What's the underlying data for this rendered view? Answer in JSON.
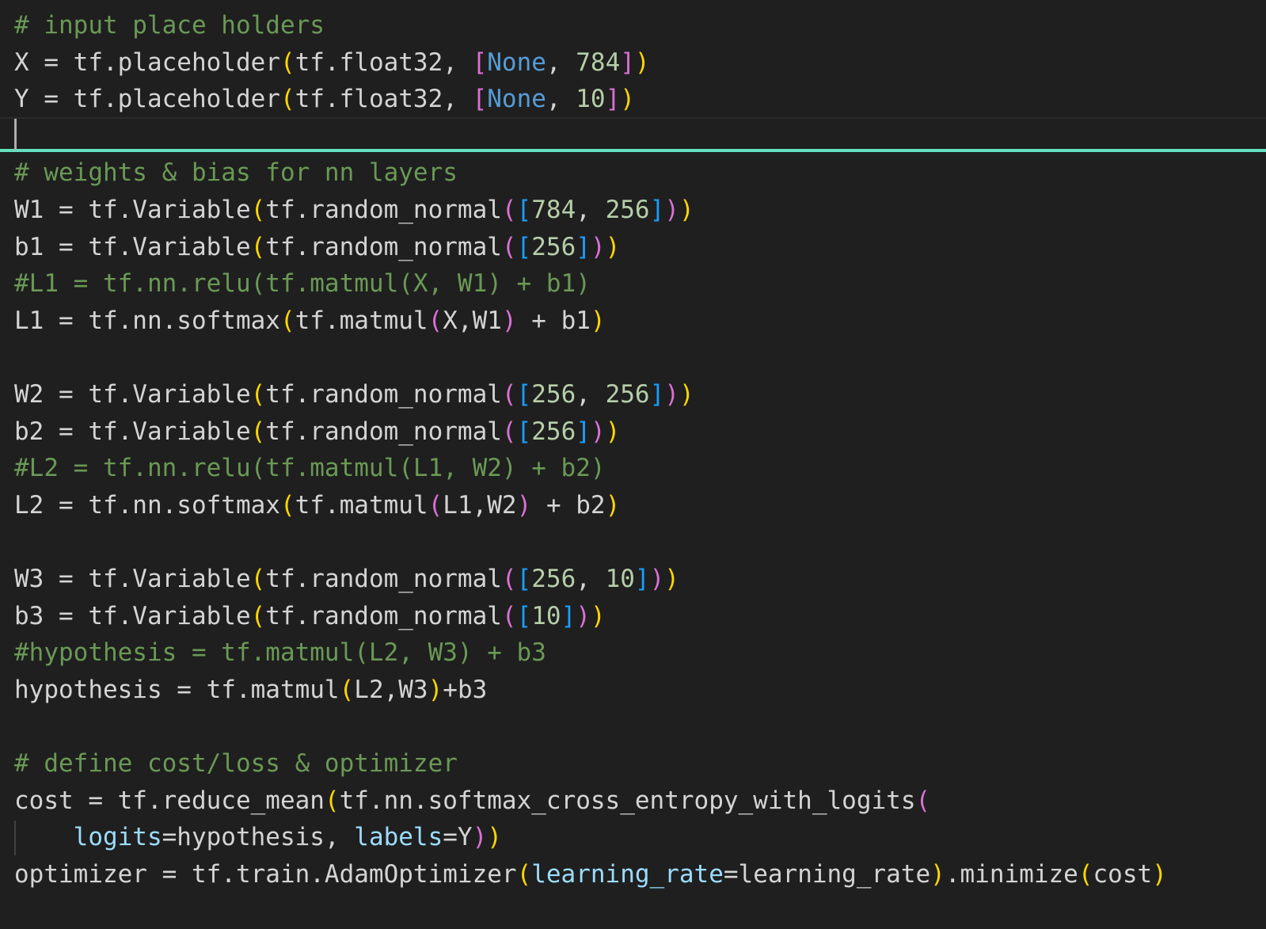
{
  "editor": {
    "colors": {
      "background": "#1f1f1f",
      "text": "#d4d4d4",
      "comment": "#6a9955",
      "number": "#b5cea8",
      "keyword": "#569cd6",
      "parameter": "#9cdcfe",
      "bracket_level_1": "#ffd700",
      "bracket_level_2": "#da70d6",
      "bracket_level_3": "#179fff",
      "active_line_border": "#64e0c0"
    },
    "lines": [
      {
        "tokens": [
          {
            "t": "# input place holders",
            "c": "cmt"
          }
        ]
      },
      {
        "tokens": [
          {
            "t": "X = tf.placeholder",
            "c": ""
          },
          {
            "t": "(",
            "c": "b1"
          },
          {
            "t": "tf.float32, ",
            "c": ""
          },
          {
            "t": "[",
            "c": "b2"
          },
          {
            "t": "None",
            "c": "kw"
          },
          {
            "t": ", ",
            "c": ""
          },
          {
            "t": "784",
            "c": "num"
          },
          {
            "t": "]",
            "c": "b2"
          },
          {
            "t": ")",
            "c": "b1"
          }
        ]
      },
      {
        "tokens": [
          {
            "t": "Y = tf.placeholder",
            "c": ""
          },
          {
            "t": "(",
            "c": "b1"
          },
          {
            "t": "tf.float32, ",
            "c": ""
          },
          {
            "t": "[",
            "c": "b2"
          },
          {
            "t": "None",
            "c": "kw"
          },
          {
            "t": ", ",
            "c": ""
          },
          {
            "t": "10",
            "c": "num"
          },
          {
            "t": "]",
            "c": "b2"
          },
          {
            "t": ")",
            "c": "b1"
          }
        ]
      },
      {
        "tokens": []
      },
      {
        "tokens": [
          {
            "t": "# weights & bias for nn layers",
            "c": "cmt"
          }
        ]
      },
      {
        "tokens": [
          {
            "t": "W1 = tf.Variable",
            "c": ""
          },
          {
            "t": "(",
            "c": "b1"
          },
          {
            "t": "tf.random_normal",
            "c": ""
          },
          {
            "t": "(",
            "c": "b2"
          },
          {
            "t": "[",
            "c": "b3"
          },
          {
            "t": "784",
            "c": "num"
          },
          {
            "t": ", ",
            "c": ""
          },
          {
            "t": "256",
            "c": "num"
          },
          {
            "t": "]",
            "c": "b3"
          },
          {
            "t": ")",
            "c": "b2"
          },
          {
            "t": ")",
            "c": "b1"
          }
        ]
      },
      {
        "tokens": [
          {
            "t": "b1 = tf.Variable",
            "c": ""
          },
          {
            "t": "(",
            "c": "b1"
          },
          {
            "t": "tf.random_normal",
            "c": ""
          },
          {
            "t": "(",
            "c": "b2"
          },
          {
            "t": "[",
            "c": "b3"
          },
          {
            "t": "256",
            "c": "num"
          },
          {
            "t": "]",
            "c": "b3"
          },
          {
            "t": ")",
            "c": "b2"
          },
          {
            "t": ")",
            "c": "b1"
          }
        ]
      },
      {
        "tokens": [
          {
            "t": "#L1 = tf.nn.relu(tf.matmul(X, W1) + b1)",
            "c": "cmt"
          }
        ]
      },
      {
        "tokens": [
          {
            "t": "L1 = tf.nn.softmax",
            "c": ""
          },
          {
            "t": "(",
            "c": "b1"
          },
          {
            "t": "tf.matmul",
            "c": ""
          },
          {
            "t": "(",
            "c": "b2"
          },
          {
            "t": "X,W1",
            "c": ""
          },
          {
            "t": ")",
            "c": "b2"
          },
          {
            "t": " + b1",
            "c": ""
          },
          {
            "t": ")",
            "c": "b1"
          }
        ]
      },
      {
        "tokens": []
      },
      {
        "tokens": [
          {
            "t": "W2 = tf.Variable",
            "c": ""
          },
          {
            "t": "(",
            "c": "b1"
          },
          {
            "t": "tf.random_normal",
            "c": ""
          },
          {
            "t": "(",
            "c": "b2"
          },
          {
            "t": "[",
            "c": "b3"
          },
          {
            "t": "256",
            "c": "num"
          },
          {
            "t": ", ",
            "c": ""
          },
          {
            "t": "256",
            "c": "num"
          },
          {
            "t": "]",
            "c": "b3"
          },
          {
            "t": ")",
            "c": "b2"
          },
          {
            "t": ")",
            "c": "b1"
          }
        ]
      },
      {
        "tokens": [
          {
            "t": "b2 = tf.Variable",
            "c": ""
          },
          {
            "t": "(",
            "c": "b1"
          },
          {
            "t": "tf.random_normal",
            "c": ""
          },
          {
            "t": "(",
            "c": "b2"
          },
          {
            "t": "[",
            "c": "b3"
          },
          {
            "t": "256",
            "c": "num"
          },
          {
            "t": "]",
            "c": "b3"
          },
          {
            "t": ")",
            "c": "b2"
          },
          {
            "t": ")",
            "c": "b1"
          }
        ]
      },
      {
        "tokens": [
          {
            "t": "#L2 = tf.nn.relu(tf.matmul(L1, W2) + b2)",
            "c": "cmt"
          }
        ]
      },
      {
        "tokens": [
          {
            "t": "L2 = tf.nn.softmax",
            "c": ""
          },
          {
            "t": "(",
            "c": "b1"
          },
          {
            "t": "tf.matmul",
            "c": ""
          },
          {
            "t": "(",
            "c": "b2"
          },
          {
            "t": "L1,W2",
            "c": ""
          },
          {
            "t": ")",
            "c": "b2"
          },
          {
            "t": " + b2",
            "c": ""
          },
          {
            "t": ")",
            "c": "b1"
          }
        ]
      },
      {
        "tokens": []
      },
      {
        "tokens": [
          {
            "t": "W3 = tf.Variable",
            "c": ""
          },
          {
            "t": "(",
            "c": "b1"
          },
          {
            "t": "tf.random_normal",
            "c": ""
          },
          {
            "t": "(",
            "c": "b2"
          },
          {
            "t": "[",
            "c": "b3"
          },
          {
            "t": "256",
            "c": "num"
          },
          {
            "t": ", ",
            "c": ""
          },
          {
            "t": "10",
            "c": "num"
          },
          {
            "t": "]",
            "c": "b3"
          },
          {
            "t": ")",
            "c": "b2"
          },
          {
            "t": ")",
            "c": "b1"
          }
        ]
      },
      {
        "tokens": [
          {
            "t": "b3 = tf.Variable",
            "c": ""
          },
          {
            "t": "(",
            "c": "b1"
          },
          {
            "t": "tf.random_normal",
            "c": ""
          },
          {
            "t": "(",
            "c": "b2"
          },
          {
            "t": "[",
            "c": "b3"
          },
          {
            "t": "10",
            "c": "num"
          },
          {
            "t": "]",
            "c": "b3"
          },
          {
            "t": ")",
            "c": "b2"
          },
          {
            "t": ")",
            "c": "b1"
          }
        ]
      },
      {
        "tokens": [
          {
            "t": "#hypothesis = tf.matmul(L2, W3) + b3",
            "c": "cmt"
          }
        ]
      },
      {
        "tokens": [
          {
            "t": "hypothesis = tf.matmul",
            "c": ""
          },
          {
            "t": "(",
            "c": "b1"
          },
          {
            "t": "L2,W3",
            "c": ""
          },
          {
            "t": ")",
            "c": "b1"
          },
          {
            "t": "+b3",
            "c": ""
          }
        ]
      },
      {
        "tokens": []
      },
      {
        "tokens": [
          {
            "t": "# define cost/loss & optimizer",
            "c": "cmt"
          }
        ]
      },
      {
        "tokens": [
          {
            "t": "cost = tf.reduce_mean",
            "c": ""
          },
          {
            "t": "(",
            "c": "b1"
          },
          {
            "t": "tf.nn.softmax_cross_entropy_with_logits",
            "c": ""
          },
          {
            "t": "(",
            "c": "b2"
          }
        ]
      },
      {
        "tokens": [
          {
            "t": "    ",
            "c": ""
          },
          {
            "t": "logits",
            "c": "var"
          },
          {
            "t": "=hypothesis, ",
            "c": ""
          },
          {
            "t": "labels",
            "c": "var"
          },
          {
            "t": "=Y",
            "c": ""
          },
          {
            "t": ")",
            "c": "b2"
          },
          {
            "t": ")",
            "c": "b1"
          }
        ]
      },
      {
        "tokens": [
          {
            "t": "optimizer = tf.train.AdamOptimizer",
            "c": ""
          },
          {
            "t": "(",
            "c": "b1"
          },
          {
            "t": "learning_rate",
            "c": "var"
          },
          {
            "t": "=learning_rate",
            "c": ""
          },
          {
            "t": ")",
            "c": "b1"
          },
          {
            "t": ".minimize",
            "c": ""
          },
          {
            "t": "(",
            "c": "b1"
          },
          {
            "t": "cost",
            "c": ""
          },
          {
            "t": ")",
            "c": "b1"
          }
        ]
      }
    ]
  }
}
